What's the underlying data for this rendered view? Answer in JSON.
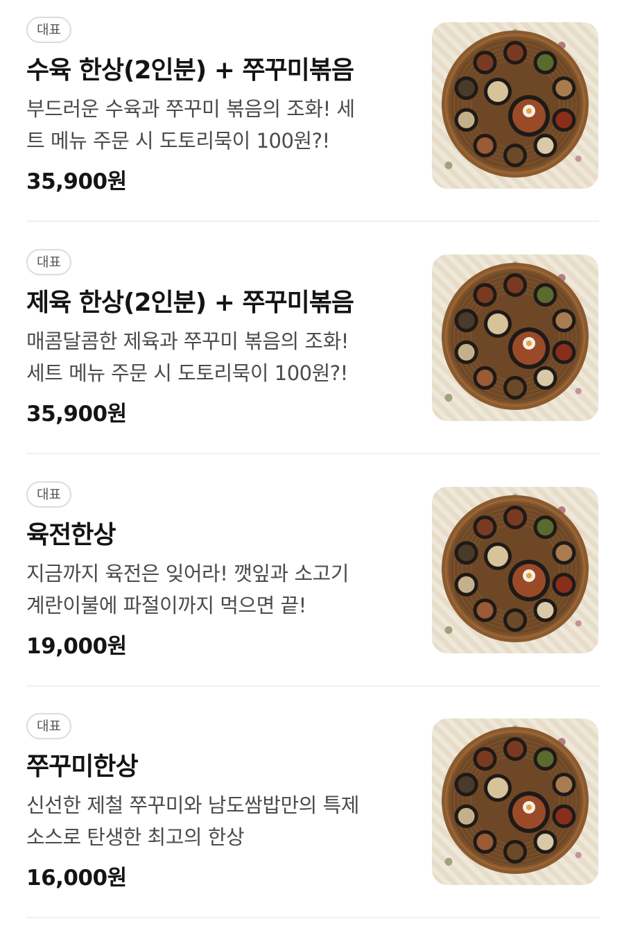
{
  "menu_items": [
    {
      "badge": "대표",
      "name": "수육 한상(2인분) + 쭈꾸미볶음",
      "desc_line1": "부드러운 수육과 쭈꾸미 볶음의 조화! 세",
      "desc_line2": "트 메뉴 주문 시 도토리묵이 100원?!",
      "price": "35,900원",
      "image": "food-platter-image"
    },
    {
      "badge": "대표",
      "name": "제육 한상(2인분) + 쭈꾸미볶음",
      "desc_line1": "매콤달콤한 제육과 쭈꾸미 볶음의 조화!",
      "desc_line2": "세트 메뉴 주문 시 도토리묵이 100원?!",
      "price": "35,900원",
      "image": "food-platter-image"
    },
    {
      "badge": "대표",
      "name": "육전한상",
      "desc_line1": "지금까지 육전은 잊어라! 깻잎과 소고기",
      "desc_line2": "계란이불에 파절이까지 먹으면 끝!",
      "price": "19,000원",
      "image": "food-platter-image"
    },
    {
      "badge": "대표",
      "name": "쭈꾸미한상",
      "desc_line1": "신선한 제철 쭈꾸미와 남도쌈밥만의 특제",
      "desc_line2": "소스로 탄생한 최고의 한상",
      "price": "16,000원",
      "image": "food-platter-image"
    }
  ],
  "colors": {
    "text_primary": "#141414",
    "text_secondary": "#4b4b4b",
    "badge_border": "#dcdcdc",
    "divider": "#f0f0f0"
  }
}
